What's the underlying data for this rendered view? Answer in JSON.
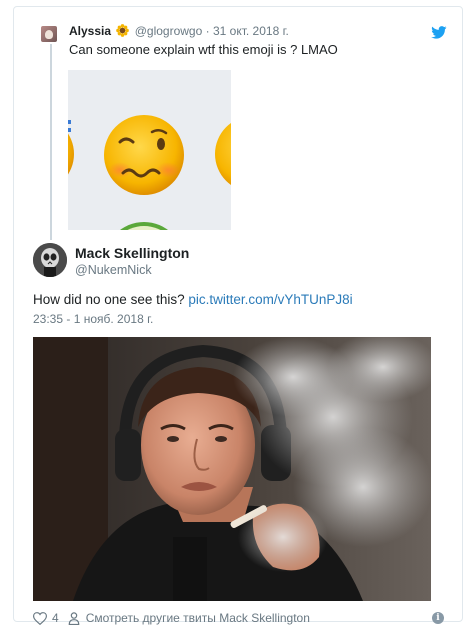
{
  "parent_tweet": {
    "author_name": "Alyssia",
    "handle": "@glogrowgo",
    "date": "31 окт. 2018 г.",
    "text": "Can someone explain wtf this emoji is ? LMAO",
    "image_icon": "woozy-face-emoji-icon"
  },
  "tweet": {
    "author_name": "Mack Skellington",
    "handle": "@NukemNick",
    "text": "How did no one see this?",
    "link": "pic.twitter.com/vYhTUnPJ8i",
    "timestamp": "23:35 - 1 нояб. 2018 г.",
    "photo_icon": "man-smoking-photo"
  },
  "footer": {
    "likes": "4",
    "more_tweets_label": "Смотреть другие твиты Mack Skellington"
  },
  "colors": {
    "link": "#2b7bb9",
    "meta": "#697882",
    "twitter_blue": "#1da1f2",
    "border": "#e1e8ed"
  }
}
